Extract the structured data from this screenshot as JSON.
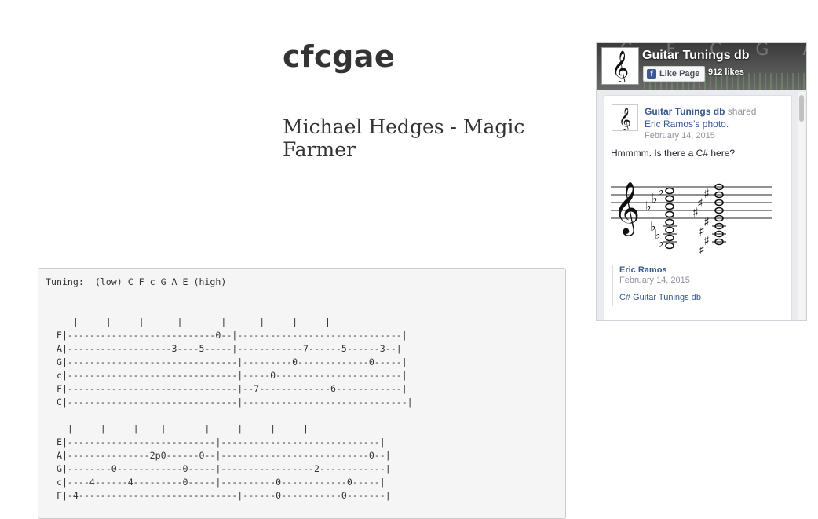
{
  "page": {
    "title": "cfcgae",
    "song": "Michael Hedges - Magic Farmer"
  },
  "tab": {
    "text": "Tuning:  (low) C F c G A E (high)\n\n\n     |     |     |      |       |      |     |     |\n  E|---------------------------0--|------------------------------|\n  A|-------------------3----5-----|------------7------5------3--|\n  G|-------------------------------|---------0-------------0-----|\n  c|-------------------------------|-----0-----------------------|\n  F|-------------------------------|--7-------------6------------|\n  C|-------------------------------|------------------------------|\n\n    |     |     |    |       |     |     |     |\n  E|---------------------------|-----------------------------|\n  A|---------------2p0------0--|---------------------------0--|\n  G|--------0------------0-----|-----------------2------------|\n  c|----4------4---------0-----|----------0------------0-----|\n  F|-4-----------------------------|------0-----------0-------|"
  },
  "facebook": {
    "page_name": "Guitar Tunings db",
    "like_label": "Like Page",
    "likes": "912 likes",
    "cover_letters": "C F C G A D",
    "post": {
      "author": "Guitar Tunings db",
      "action": "shared",
      "source": "Eric Ramos’s photo.",
      "date": "February 14, 2015",
      "text": "Hmmmm. Is there a C# here?",
      "shared_author": "Eric Ramos",
      "shared_date": "February 14, 2015",
      "shared_text": "C# Guitar Tunings db"
    },
    "colors": {
      "link": "#365899",
      "meta": "#90949c",
      "feed_bg": "#e9ebee"
    }
  }
}
